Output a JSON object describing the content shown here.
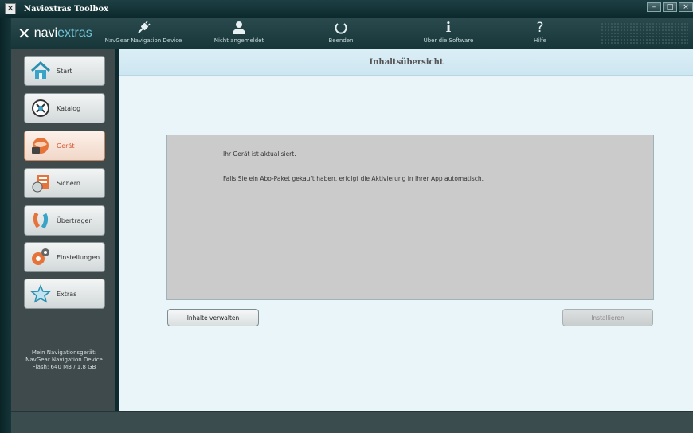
{
  "window": {
    "title": "Naviextras Toolbox",
    "buttons": [
      "–",
      "□",
      "×"
    ]
  },
  "toolbar": {
    "brand_a": "navi",
    "brand_b": "extras",
    "items": [
      {
        "label": "NavGear Navigation Device",
        "icon": "plug-icon"
      },
      {
        "label": "Nicht angemeldet",
        "icon": "user-icon"
      },
      {
        "label": "Beenden",
        "icon": "power-icon"
      },
      {
        "label": "Über die Software",
        "icon": "info-icon"
      },
      {
        "label": "Hilfe",
        "icon": "help-icon"
      }
    ]
  },
  "sidebar": {
    "items": [
      {
        "label": "Start",
        "icon": "home-icon"
      },
      {
        "label": "Katalog",
        "icon": "catalog-icon"
      },
      {
        "label": "Gerät",
        "icon": "device-icon",
        "active": true
      },
      {
        "label": "Sichern",
        "icon": "backup-icon"
      },
      {
        "label": "Übertragen",
        "icon": "transfer-icon"
      },
      {
        "label": "Einstellungen",
        "icon": "settings-icon"
      },
      {
        "label": "Extras",
        "icon": "star-icon"
      }
    ],
    "device_info": {
      "line1": "Mein Navigationsgerät:",
      "line2": "NavGear Navigation Device",
      "line3": "Flash: 640 MB / 1.8 GB"
    }
  },
  "main": {
    "header": "Inhaltsübersicht",
    "message1": "Ihr Gerät ist aktualisiert.",
    "message2": "Falls Sie ein Abo-Paket gekauft haben, erfolgt die Aktivierung in Ihrer App automatisch.",
    "manage_button": "Inhalte verwalten",
    "install_button": "Installieren"
  },
  "colors": {
    "accent": "#6fc3d6",
    "active_text": "#d4522a",
    "content_bg": "#eaf5fa"
  }
}
